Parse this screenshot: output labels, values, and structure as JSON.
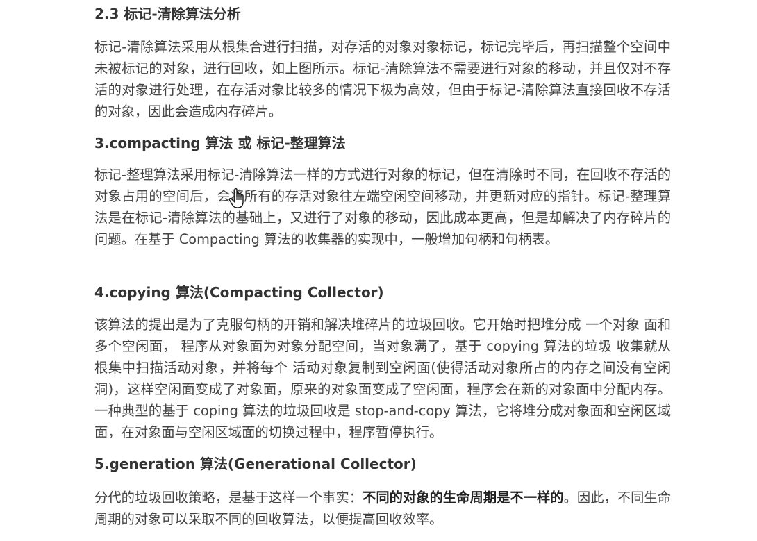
{
  "sections": [
    {
      "heading": "2.3 标记-清除算法分析",
      "body": "标记-清除算法采用从根集合进行扫描，对存活的对象对象标记，标记完毕后，再扫描整个空间中未被标记的对象，进行回收，如上图所示。标记-清除算法不需要进行对象的移动，并且仅对不存活的对象进行处理，在存活对象比较多的情况下极为高效，但由于标记-清除算法直接回收不存活的对象，因此会造成内存碎片。"
    },
    {
      "heading": "3.compacting 算法 或 标记-整理算法",
      "body": "标记-整理算法采用标记-清除算法一样的方式进行对象的标记，但在清除时不同，在回收不存活的对象占用的空间后，会将所有的存活对象往左端空闲空间移动，并更新对应的指针。标记-整理算法是在标记-清除算法的基础上，又进行了对象的移动，因此成本更高，但是却解决了内存碎片的问题。在基于 Compacting 算法的收集器的实现中，一般增加句柄和句柄表。"
    },
    {
      "heading": "4.copying 算法(Compacting Collector)",
      "body": "该算法的提出是为了克服句柄的开销和解决堆碎片的垃圾回收。它开始时把堆分成 一个对象 面和多个空闲面， 程序从对象面为对象分配空间，当对象满了，基于 copying 算法的垃圾 收集就从根集中扫描活动对象，并将每个 活动对象复制到空闲面(使得活动对象所占的内存之间没有空闲洞)，这样空闲面变成了对象面，原来的对象面变成了空闲面，程序会在新的对象面中分配内存。一种典型的基于 coping 算法的垃圾回收是 stop-and-copy 算法，它将堆分成对象面和空闲区域面，在对象面与空闲区域面的切换过程中，程序暂停执行。"
    },
    {
      "heading": "5.generation 算法(Generational Collector)",
      "body_before": "分代的垃圾回收策略，是基于这样一个事实：",
      "body_strong": "不同的对象的生命周期是不一样的",
      "body_after": "。因此，不同生命周期的对象可以采取不同的回收算法，以便提高回收效率。"
    }
  ],
  "cursor_icon": "hand-pointer-icon"
}
